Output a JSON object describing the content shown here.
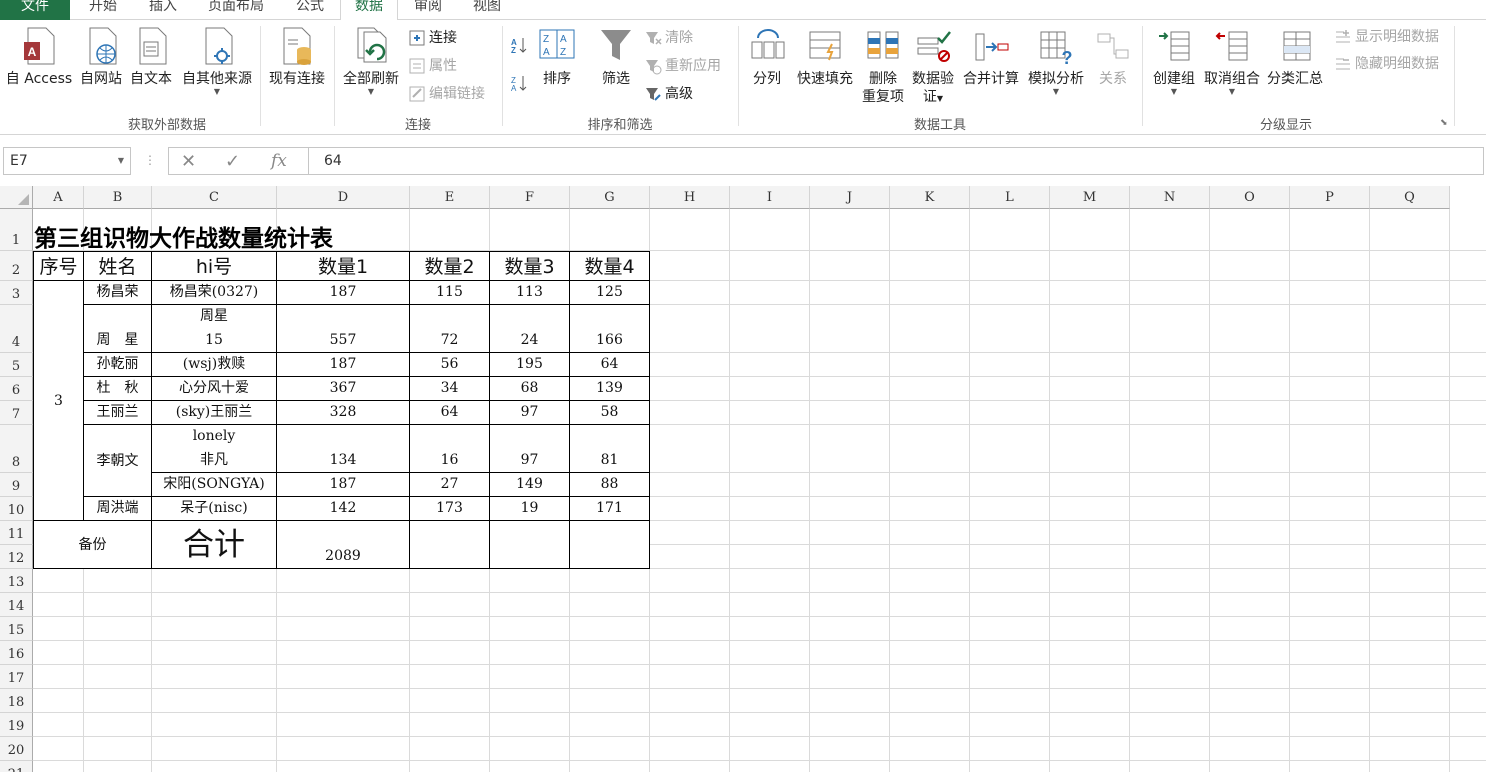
{
  "tabs": [
    {
      "label": "文件"
    },
    {
      "label": "开始"
    },
    {
      "label": "插入"
    },
    {
      "label": "页面布局"
    },
    {
      "label": "公式"
    },
    {
      "label": "数据"
    },
    {
      "label": "审阅"
    },
    {
      "label": "视图"
    }
  ],
  "ribbon": {
    "groups": {
      "external": "获取外部数据",
      "connections": "连接",
      "sort_filter": "排序和筛选",
      "data_tools": "数据工具",
      "outline": "分级显示"
    },
    "btn_access": "自 Access",
    "btn_web": "自网站",
    "btn_text": "自文本",
    "btn_other": "自其他来源",
    "btn_existing": "现有连接",
    "btn_refresh_all": "全部刷新",
    "btn_connections": "连接",
    "btn_properties": "属性",
    "btn_edit_links": "编辑链接",
    "btn_sort": "排序",
    "btn_filter": "筛选",
    "btn_clear": "清除",
    "btn_reapply": "重新应用",
    "btn_advanced": "高级",
    "btn_text_to_columns": "分列",
    "btn_flash_fill": "快速填充",
    "btn_remove_dup_1": "删除",
    "btn_remove_dup_2": "重复项",
    "btn_validation_1": "数据验",
    "btn_validation_2": "证",
    "btn_consolidate": "合并计算",
    "btn_whatif": "模拟分析",
    "btn_relationships": "关系",
    "btn_group": "创建组",
    "btn_ungroup": "取消组合",
    "btn_subtotal": "分类汇总",
    "btn_show_detail": "显示明细数据",
    "btn_hide_detail": "隐藏明细数据"
  },
  "formula_bar": {
    "name_box": "E7",
    "value": "64",
    "fx": "fx"
  },
  "columns": [
    "A",
    "B",
    "C",
    "D",
    "E",
    "F",
    "G",
    "H",
    "I",
    "J",
    "K",
    "L",
    "M",
    "N",
    "O",
    "P",
    "Q"
  ],
  "rows": [
    "1",
    "2",
    "3",
    "4",
    "5",
    "6",
    "7",
    "8",
    "9",
    "10",
    "11",
    "12",
    "13",
    "14",
    "15",
    "16",
    "17",
    "18",
    "19",
    "20",
    "21"
  ],
  "sheet": {
    "title": "第三组识物大作战数量统计表",
    "headers": [
      "序号",
      "姓名",
      "hi号",
      "数量1",
      "数量2",
      "数量3",
      "数量4"
    ],
    "group_no": "3",
    "records": [
      {
        "name": "杨昌荣",
        "hi": "杨昌荣(0327)",
        "q1": "187",
        "q2": "115",
        "q3": "113",
        "q4": "125"
      },
      {
        "name": "周　星",
        "hi": "周星\n15",
        "q1": "557",
        "q2": "72",
        "q3": "24",
        "q4": "166"
      },
      {
        "name": "孙乾丽",
        "hi": "(wsj)救赎",
        "q1": "187",
        "q2": "56",
        "q3": "195",
        "q4": "64"
      },
      {
        "name": "杜　秋",
        "hi": "心分风十爱",
        "q1": "367",
        "q2": "34",
        "q3": "68",
        "q4": "139"
      },
      {
        "name": "王丽兰",
        "hi": "(sky)王丽兰",
        "q1": "328",
        "q2": "64",
        "q3": "97",
        "q4": "58"
      },
      {
        "name": "李朝文",
        "hi": "lonely\n非凡",
        "q1": "134",
        "q2": "16",
        "q3": "97",
        "q4": "81"
      },
      {
        "name": "",
        "hi": "宋阳(SONGYA)",
        "q1": "187",
        "q2": "27",
        "q3": "149",
        "q4": "88"
      },
      {
        "name": "周洪端",
        "hi": "呆子(nisc)",
        "q1": "142",
        "q2": "173",
        "q3": "19",
        "q4": "171"
      }
    ],
    "backup_label": "备份",
    "total_label": "合计",
    "total_value": "2089"
  }
}
